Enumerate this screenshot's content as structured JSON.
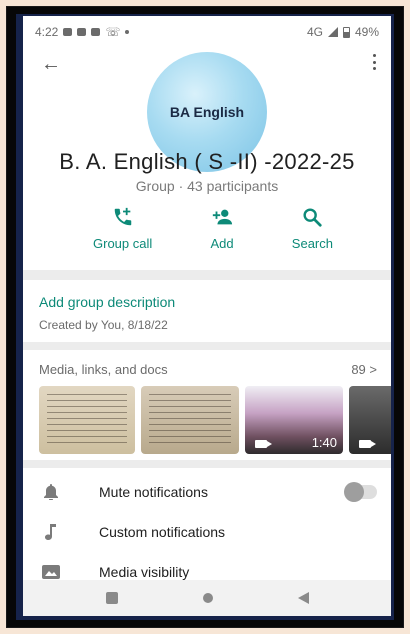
{
  "status": {
    "time": "4:22",
    "network": "4G",
    "battery": "49%"
  },
  "avatar": {
    "text": "BA English"
  },
  "group": {
    "title": "B. A. English ( S -II) -2022-25",
    "subtitle": "Group · 43 participants"
  },
  "actions": [
    {
      "label": "Group call",
      "icon": "add-call-icon"
    },
    {
      "label": "Add",
      "icon": "add-person-icon"
    },
    {
      "label": "Search",
      "icon": "search-icon"
    }
  ],
  "description": {
    "add_label": "Add group description",
    "created_by": "Created by You, 8/18/22"
  },
  "media": {
    "title": "Media, links, and docs",
    "count": "89 >",
    "video_duration": "1:40"
  },
  "settings": [
    {
      "label": "Mute notifications",
      "icon": "bell-icon",
      "toggle": false
    },
    {
      "label": "Custom notifications",
      "icon": "music-note-icon"
    },
    {
      "label": "Media visibility",
      "icon": "image-icon"
    }
  ],
  "colors": {
    "accent": "#0d8a78",
    "page_bg": "#f7e6d6",
    "frame": "#16234a"
  }
}
